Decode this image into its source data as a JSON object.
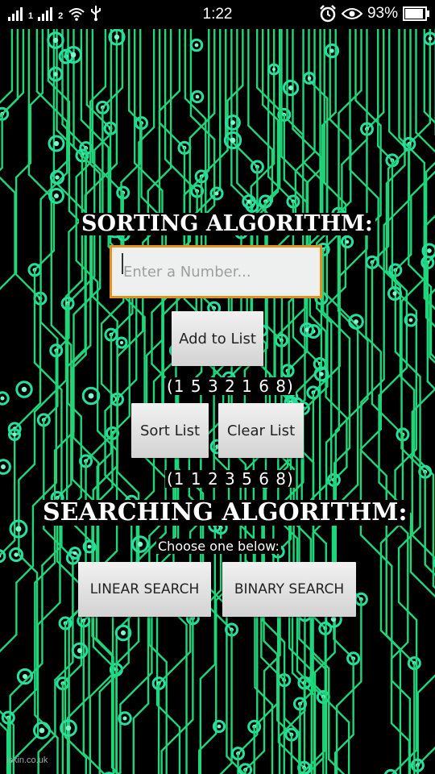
{
  "status_bar": {
    "time": "1:22",
    "sim1": "1",
    "sim2": "2",
    "battery_percent": "93%",
    "battery_level": 0.93,
    "icons": [
      "signal-icon",
      "wifi-icon",
      "usb-icon",
      "alarm-icon",
      "eye-icon",
      "battery-icon"
    ]
  },
  "sorting": {
    "heading": "SORTING ALGORITHM:",
    "input_placeholder": "Enter a Number...",
    "input_value": "",
    "add_button": "Add to List",
    "original_list": "(1 5 3 2 1 6 8)",
    "sort_button": "Sort List",
    "clear_button": "Clear List",
    "sorted_list": "(1 1 2 3 5 6 8)"
  },
  "searching": {
    "heading": "SEARCHING ALGORITHM:",
    "prompt": "Choose one below:",
    "linear_button": "LINEAR SEARCH",
    "binary_button": "BINARY SEARCH"
  },
  "watermark": "iskin.co.uk",
  "colors": {
    "background": "#000000",
    "trace": "#1fd67a",
    "input_border": "#e5911d",
    "button": "#dedede"
  }
}
